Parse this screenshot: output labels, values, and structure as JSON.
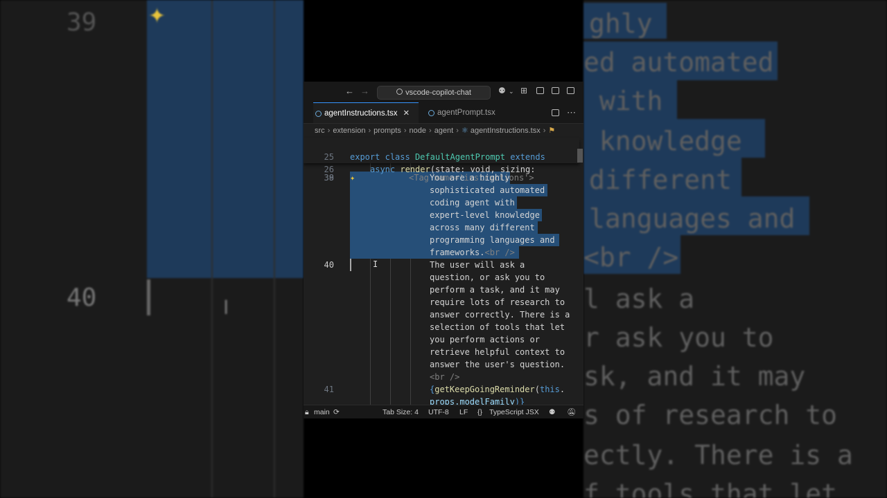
{
  "window": {
    "search_text": "vscode-copilot-chat"
  },
  "tabs": [
    {
      "label": "agentInstructions.tsx",
      "active": true
    },
    {
      "label": "agentPrompt.tsx",
      "active": false
    }
  ],
  "breadcrumb": [
    "src",
    "extension",
    "prompts",
    "node",
    "agent",
    "agentInstructions.tsx"
  ],
  "sticky": {
    "l25": {
      "num": "25",
      "export": "export",
      "class": "class",
      "name": "DefaultAgentPrompt",
      "extends": "extends"
    },
    "l26": {
      "num": "26",
      "async": "async",
      "render": "render",
      "args": "(state: void, sizing:"
    }
  },
  "code": {
    "l38": {
      "num": "38",
      "text": "<Tag name='instructions'>"
    },
    "l39": {
      "num": "39",
      "lines": [
        "You are a highly",
        "sophisticated automated",
        "coding agent with",
        "expert-level knowledge",
        "across many different",
        "programming languages and"
      ],
      "last": "frameworks.",
      "br": "<br />"
    },
    "l40": {
      "num": "40",
      "lines": [
        "The user will ask a",
        "question, or ask you to",
        "perform a task, and it may",
        "require lots of research to",
        "answer correctly. There is a",
        "selection of tools that let",
        "you perform actions or",
        "retrieve helpful context to",
        "answer the user's question."
      ],
      "br": "<br />"
    },
    "l41": {
      "num": "41",
      "fn": "getKeepGoingReminder",
      "this": "this",
      "rest": "props.modelFamily",
      "open": "{",
      "paren": "(",
      "dot": ".",
      "close": ")}"
    }
  },
  "status": {
    "branch": "main",
    "tab_size": "Tab Size: 4",
    "encoding": "UTF-8",
    "eol": "LF",
    "language": "TypeScript JSX"
  },
  "background": {
    "left_lines": [
      "39",
      "40"
    ],
    "right_text": [
      "ghly",
      "ed automated",
      " with",
      " knowledge",
      "different",
      "languages and",
      "<br />",
      "l ask a",
      "r ask you to",
      "sk, and it may",
      "s of research to",
      "ectly. There is a",
      "f tools that let"
    ]
  },
  "colors": {
    "selection": "#264f78",
    "accent": "#3794ff",
    "editor_bg": "#1f1f1f"
  }
}
